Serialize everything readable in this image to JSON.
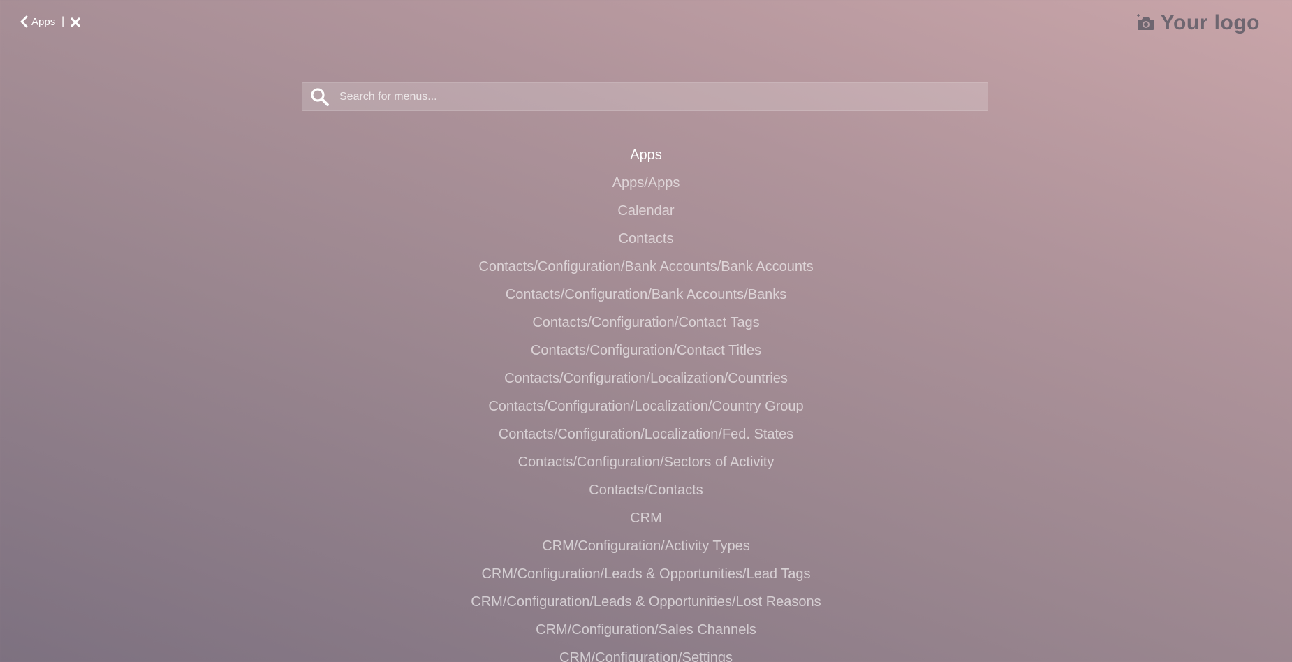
{
  "topbar": {
    "back_label": "Apps",
    "separator": "|",
    "logo_text": "Your logo"
  },
  "search": {
    "placeholder": "Search for menus...",
    "value": ""
  },
  "menu_items": [
    {
      "label": "Apps",
      "active": true
    },
    {
      "label": "Apps/Apps"
    },
    {
      "label": "Calendar"
    },
    {
      "label": "Contacts"
    },
    {
      "label": "Contacts/Configuration/Bank Accounts/Bank Accounts"
    },
    {
      "label": "Contacts/Configuration/Bank Accounts/Banks"
    },
    {
      "label": "Contacts/Configuration/Contact Tags"
    },
    {
      "label": "Contacts/Configuration/Contact Titles"
    },
    {
      "label": "Contacts/Configuration/Localization/Countries"
    },
    {
      "label": "Contacts/Configuration/Localization/Country Group"
    },
    {
      "label": "Contacts/Configuration/Localization/Fed. States"
    },
    {
      "label": "Contacts/Configuration/Sectors of Activity"
    },
    {
      "label": "Contacts/Contacts"
    },
    {
      "label": "CRM"
    },
    {
      "label": "CRM/Configuration/Activity Types"
    },
    {
      "label": "CRM/Configuration/Leads & Opportunities/Lead Tags"
    },
    {
      "label": "CRM/Configuration/Leads & Opportunities/Lost Reasons"
    },
    {
      "label": "CRM/Configuration/Sales Channels"
    },
    {
      "label": "CRM/Configuration/Settings"
    }
  ],
  "icons": {
    "back": "chevron-left-icon",
    "close": "close-icon",
    "logo": "camera-icon",
    "search": "search-icon"
  }
}
